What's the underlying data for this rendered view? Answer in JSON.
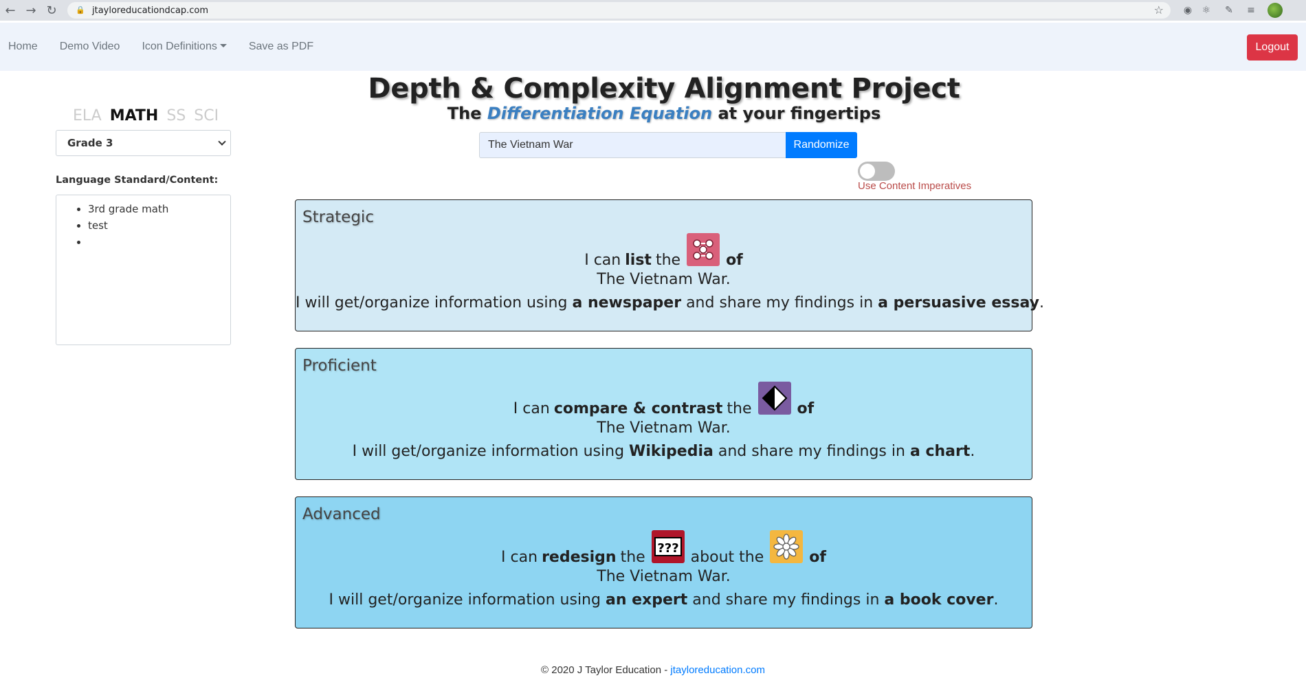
{
  "browser": {
    "url": "jtayloreducationdcap.com"
  },
  "nav": {
    "home": "Home",
    "demo_video": "Demo Video",
    "icon_definitions": "Icon Definitions",
    "save_pdf": "Save as PDF",
    "logout": "Logout"
  },
  "header": {
    "title": "Depth & Complexity Alignment Project",
    "subtitle_pre": "The ",
    "subtitle_accent": "Differentiation Equation",
    "subtitle_post": " at your fingertips"
  },
  "search": {
    "value": "The Vietnam War",
    "button": "Randomize"
  },
  "toggle": {
    "label": "Use Content Imperatives",
    "on": false
  },
  "sidebar": {
    "subjects": [
      "ELA",
      "MATH",
      "SS",
      "SCI"
    ],
    "active_subject": "MATH",
    "grade": "Grade 3",
    "lang_label": "Language Standard/Content:",
    "items": [
      "3rd grade math",
      "test",
      ""
    ]
  },
  "cards": [
    {
      "title": "Strategic",
      "i_can": "I can",
      "verb": "list",
      "the": "the",
      "icon": "details-icon",
      "of": "of",
      "topic": "The Vietnam War.",
      "l3_pre": "I will get/organize information using",
      "source": "a newspaper",
      "l3_mid": "and share my findings in",
      "product": "a persuasive essay",
      "end": "."
    },
    {
      "title": "Proficient",
      "i_can": "I can",
      "verb": "compare & contrast",
      "the": "the",
      "icon": "contrast-icon",
      "of": "of",
      "topic": "The Vietnam War.",
      "l3_pre": "I will get/organize information using",
      "source": "Wikipedia",
      "l3_mid": "and share my findings in",
      "product": "a chart",
      "end": "."
    },
    {
      "title": "Advanced",
      "i_can": "I can",
      "verb": "redesign",
      "the": "the",
      "icon": "unanswered-questions-icon",
      "about_the": "about the",
      "icon2": "big-idea-icon",
      "of": "of",
      "topic": "The Vietnam War.",
      "l3_pre": "I will get/organize information using",
      "source": "an expert",
      "l3_mid": "and share my findings in",
      "product": "a book cover",
      "end": "."
    }
  ],
  "footer": {
    "copyright": "© 2020 J Taylor Education - ",
    "link": "jtayloreducation.com"
  }
}
